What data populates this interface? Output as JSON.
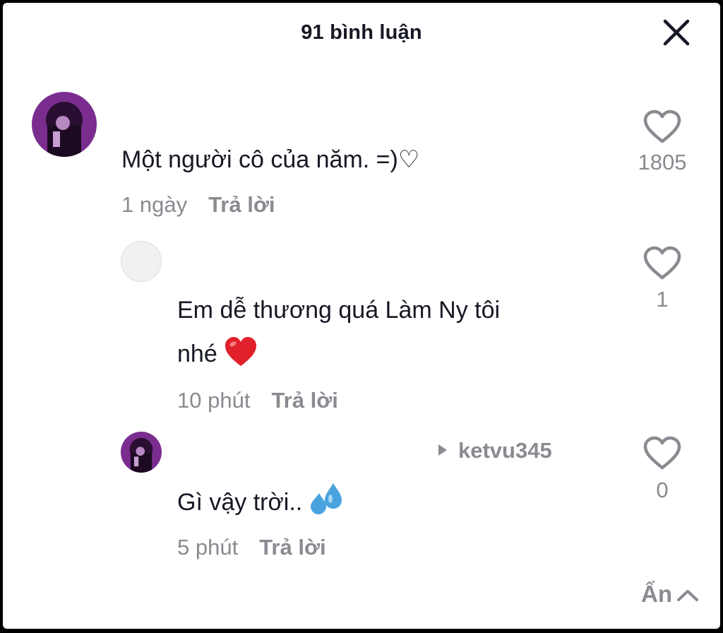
{
  "header": {
    "title": "91 bình luận",
    "close_icon": "close-icon"
  },
  "comments": [
    {
      "text": "Một người cô của năm. =)♡",
      "time": "1 ngày",
      "reply_label": "Trả lời",
      "likes": "1805",
      "avatar": "purple-photo-avatar"
    },
    {
      "text_line1": "Em dễ thương quá Làm Ny tôi",
      "text_line2": "nhé",
      "emoji": "red-heart-emoji",
      "time": "10 phút",
      "reply_label": "Trả lời",
      "likes": "1",
      "avatar": "empty-avatar"
    },
    {
      "reply_to": "ketvu345",
      "text": "Gì vậy trời..",
      "emoji": "sweat-droplets-emoji",
      "time": "5 phút",
      "reply_label": "Trả lời",
      "likes": "0",
      "avatar": "purple-photo-avatar"
    }
  ],
  "footer": {
    "hide_label": "Ẩn"
  },
  "colors": {
    "text": "#161823",
    "muted": "#8a8b91",
    "heart": "#e0202a",
    "avatar_purple": "#7a2d8f"
  }
}
